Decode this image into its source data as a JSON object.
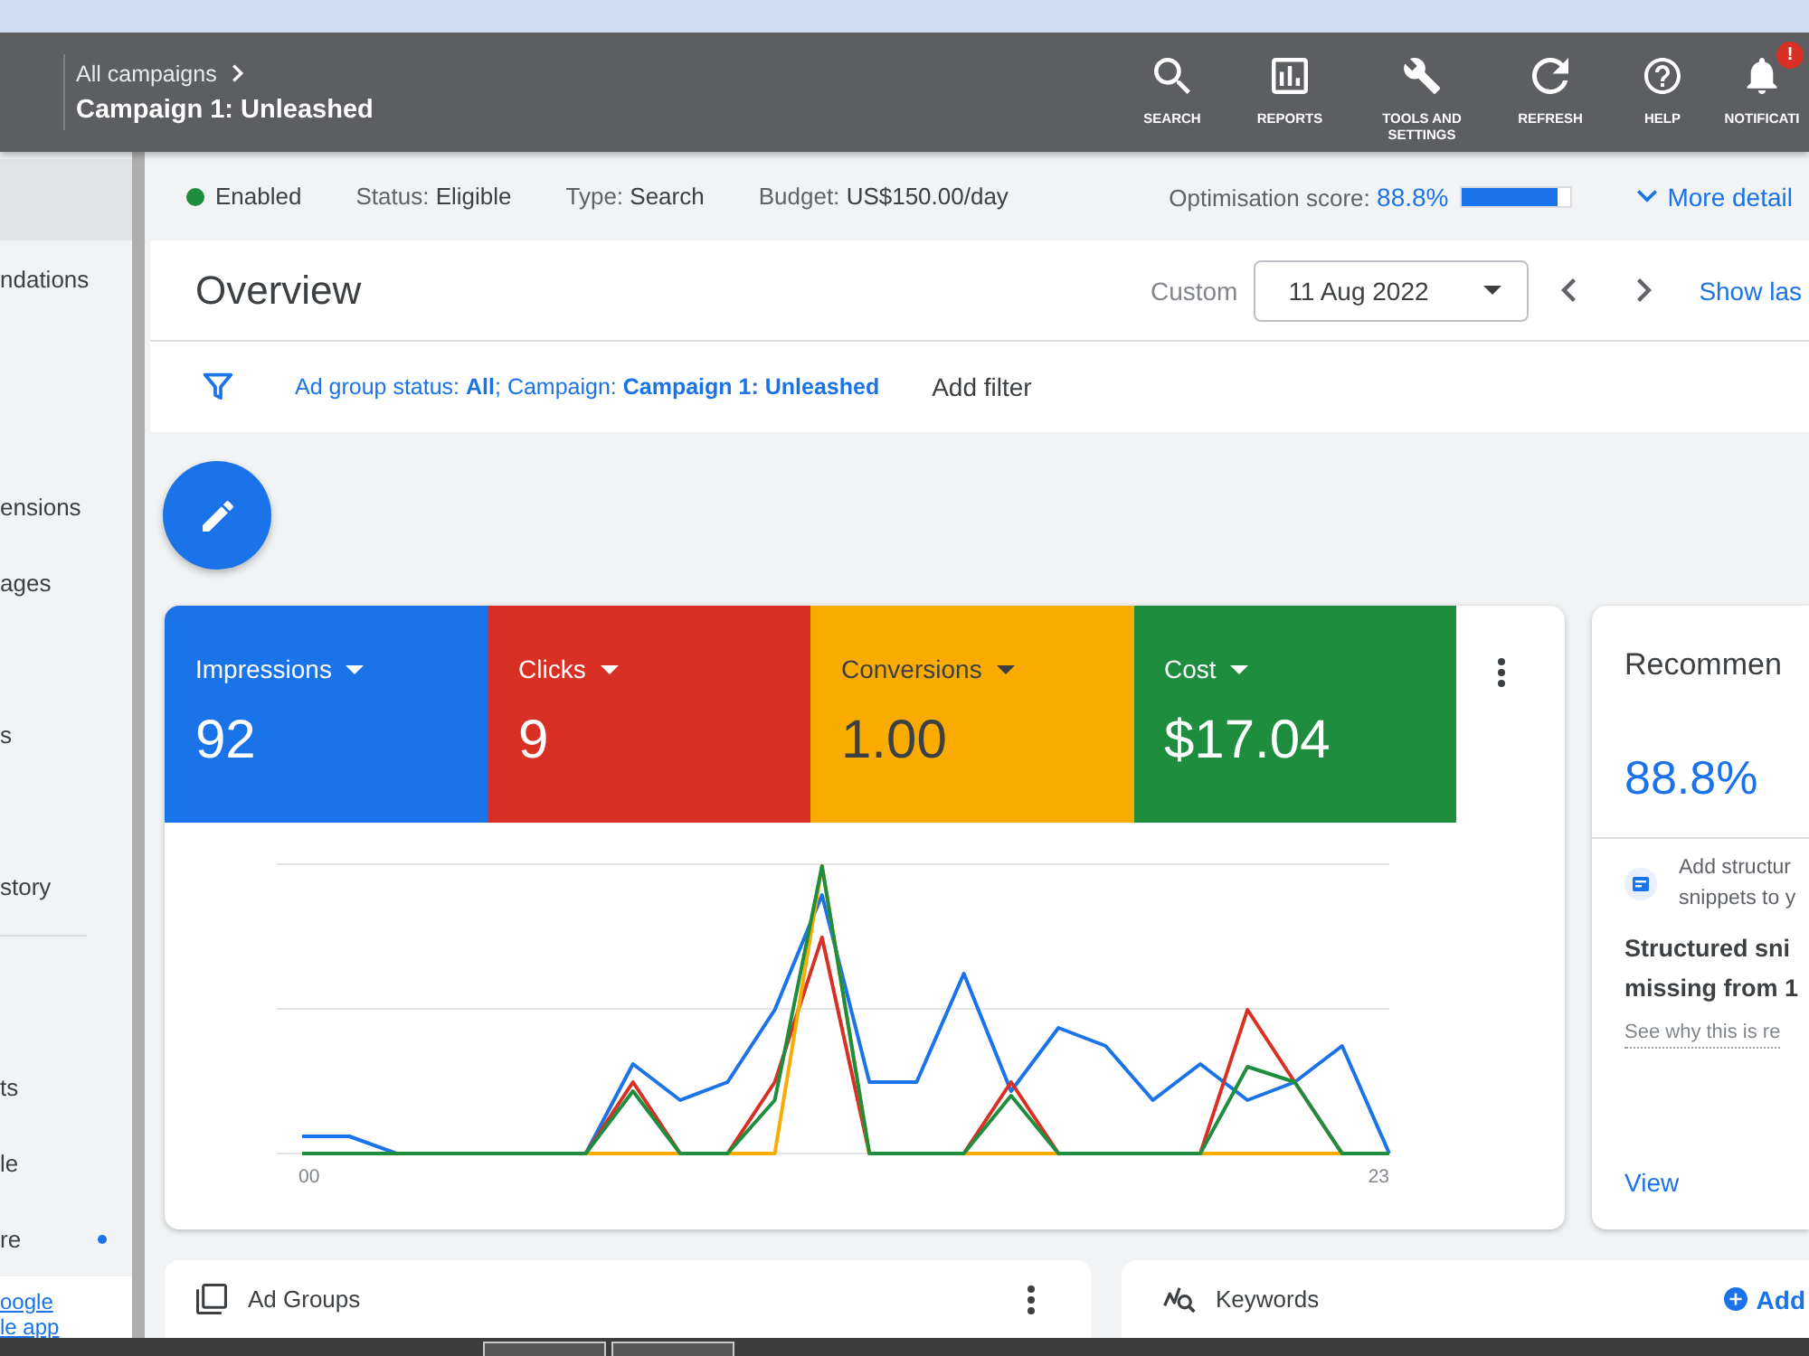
{
  "header": {
    "breadcrumb": "All campaigns",
    "title": "Campaign 1: Unleashed",
    "tools": [
      {
        "kind": "search",
        "label": "SEARCH"
      },
      {
        "kind": "reports",
        "label": "REPORTS"
      },
      {
        "kind": "tools",
        "label": "TOOLS AND SETTINGS"
      },
      {
        "kind": "refresh",
        "label": "REFRESH"
      },
      {
        "kind": "help",
        "label": "HELP"
      },
      {
        "kind": "notifications",
        "label": "NOTIFICATI",
        "badge": "!"
      }
    ]
  },
  "sidebar": {
    "sections": [
      {
        "items": [
          {
            "selected": true,
            "dot": false
          },
          {
            "label": "ndations",
            "selected": false,
            "dot": false
          },
          {
            "label": "ensions",
            "selected": false,
            "dot": false
          },
          {
            "label": "ages",
            "selected": false,
            "dot": false
          },
          {
            "label": "s",
            "selected": false,
            "dot": false
          },
          {
            "label": "story",
            "selected": false,
            "dot": false
          }
        ]
      },
      {
        "items": [
          {
            "label": "ts",
            "selected": false,
            "dot": false
          },
          {
            "label": "le",
            "selected": false,
            "dot": false
          },
          {
            "label": "re",
            "selected": false,
            "dot": true
          }
        ]
      }
    ],
    "app_link": [
      "oogle",
      "le app"
    ]
  },
  "status_bar": {
    "campaign_status": {
      "label": "Enabled",
      "enabled": true
    },
    "details": [
      {
        "label": "Status:",
        "value": "Eligible"
      },
      {
        "label": "Type:",
        "value": "Search"
      },
      {
        "label": "Budget:",
        "value": "US$150.00/day"
      }
    ],
    "optimisation": {
      "label": "Optimisation score:",
      "value": "88.8%",
      "level": 0.888
    },
    "more_link": "More detail"
  },
  "overview": {
    "title": "Overview",
    "range_label": "Custom",
    "date": "11 Aug 2022",
    "show_link": "Show las"
  },
  "filter": {
    "text": "Ad group status: **All**; Campaign: **Campaign 1: Unleashed**",
    "add_label": "Add filter"
  },
  "metrics": [
    {
      "label": "Impressions",
      "value": "92",
      "color": "#1a73e8",
      "selected": true
    },
    {
      "label": "Clicks",
      "value": "9",
      "color": "#d93025",
      "selected": true
    },
    {
      "label": "Conversions",
      "value": "1.00",
      "color": "#f9ab00",
      "selected": true
    },
    {
      "label": "Cost",
      "value": "$17.04",
      "color": "#1e8e3e",
      "selected": true
    }
  ],
  "chart": {
    "x_labels": [
      "00",
      "23"
    ]
  },
  "recommendations": {
    "title": "Recommen",
    "score": "88.8%",
    "type_lines": [
      "Add structur",
      "snippets to y"
    ],
    "headline_lines": [
      "Structured sni",
      "missing from 1"
    ],
    "link": "See why this is re",
    "action": "View"
  },
  "cards": [
    {
      "kind": "ad_groups",
      "title": "Ad Groups",
      "menu": true
    },
    {
      "kind": "keywords",
      "title": "Keywords",
      "menu": false,
      "action": "Add"
    }
  ]
}
